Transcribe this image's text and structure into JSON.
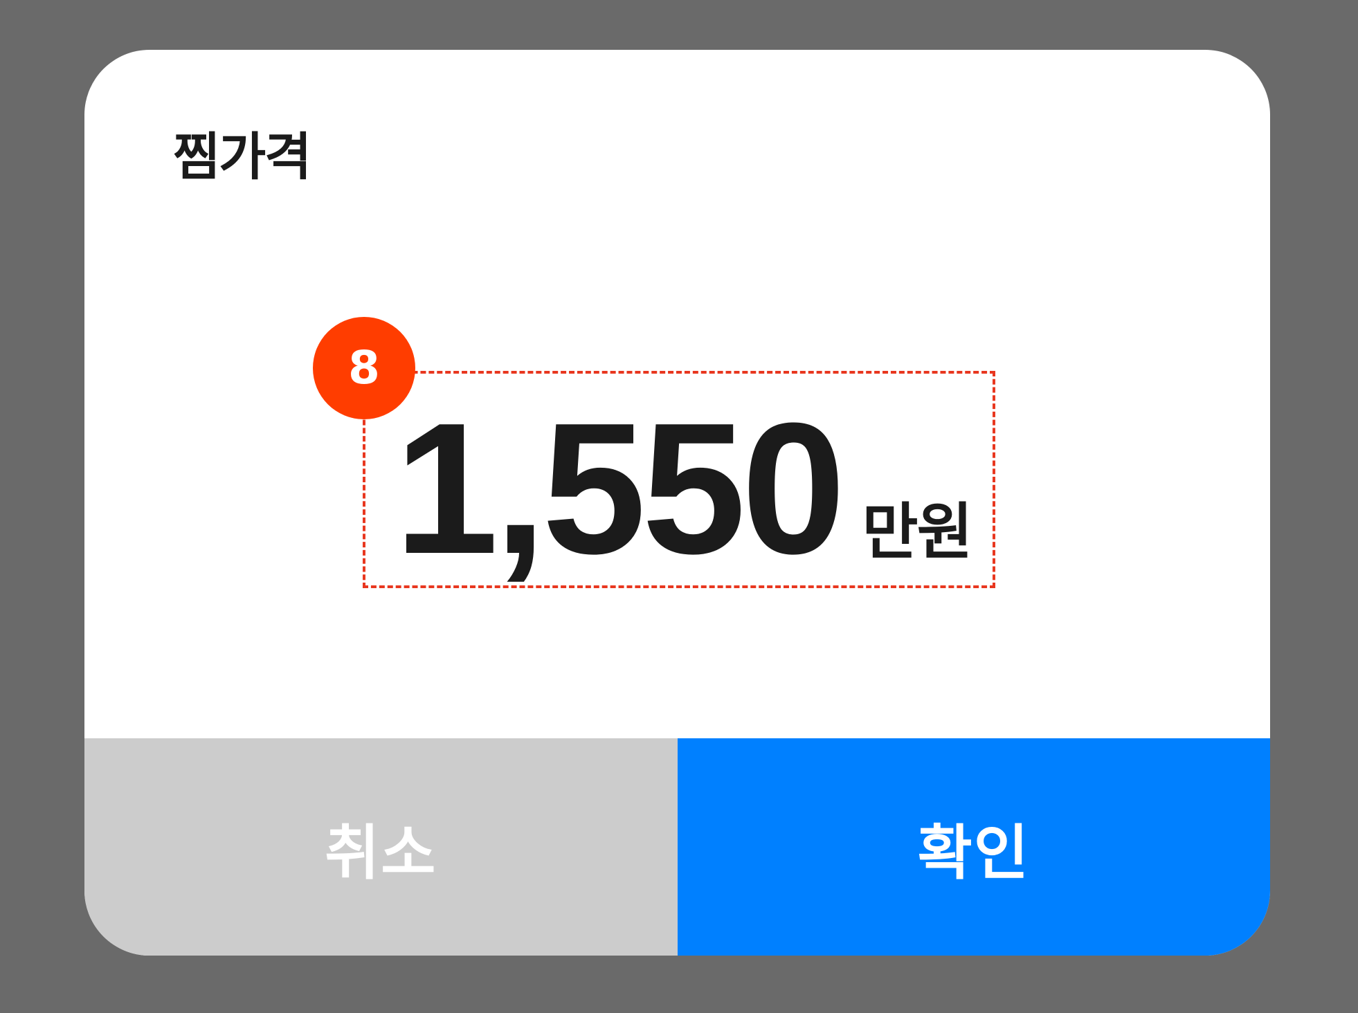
{
  "dialog": {
    "title": "찜가격",
    "annotation_badge": "8",
    "price": {
      "value": "1,550",
      "unit": "만원"
    },
    "buttons": {
      "cancel_label": "취소",
      "confirm_label": "확인"
    }
  },
  "colors": {
    "overlay": "#6a6a6a",
    "dialog_background": "#ffffff",
    "cancel_button": "#cccccc",
    "confirm_button": "#0080ff",
    "annotation": "#ff3d00"
  }
}
